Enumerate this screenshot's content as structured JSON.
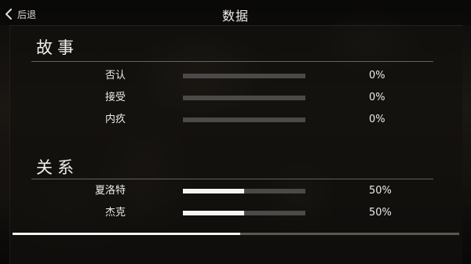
{
  "header": {
    "back_label": "后退",
    "title": "数据"
  },
  "sections": {
    "story": {
      "heading": "故事",
      "rows": [
        {
          "label": "否认",
          "value_text": "0%",
          "fill": 0.0
        },
        {
          "label": "接受",
          "value_text": "0%",
          "fill": 0.0
        },
        {
          "label": "内疚",
          "value_text": "0%",
          "fill": 0.0
        }
      ]
    },
    "relations": {
      "heading": "关系",
      "rows": [
        {
          "label": "夏洛特",
          "value_text": "50%",
          "fill": 0.5
        },
        {
          "label": "杰克",
          "value_text": "50%",
          "fill": 0.5
        }
      ]
    }
  },
  "scroll": {
    "fraction": 0.51
  },
  "colors": {
    "bar_fill": "#f4f4f2",
    "bar_track": "#4b4a48",
    "text": "#eeece8"
  },
  "icons": {
    "back": "chevron-left-icon"
  }
}
